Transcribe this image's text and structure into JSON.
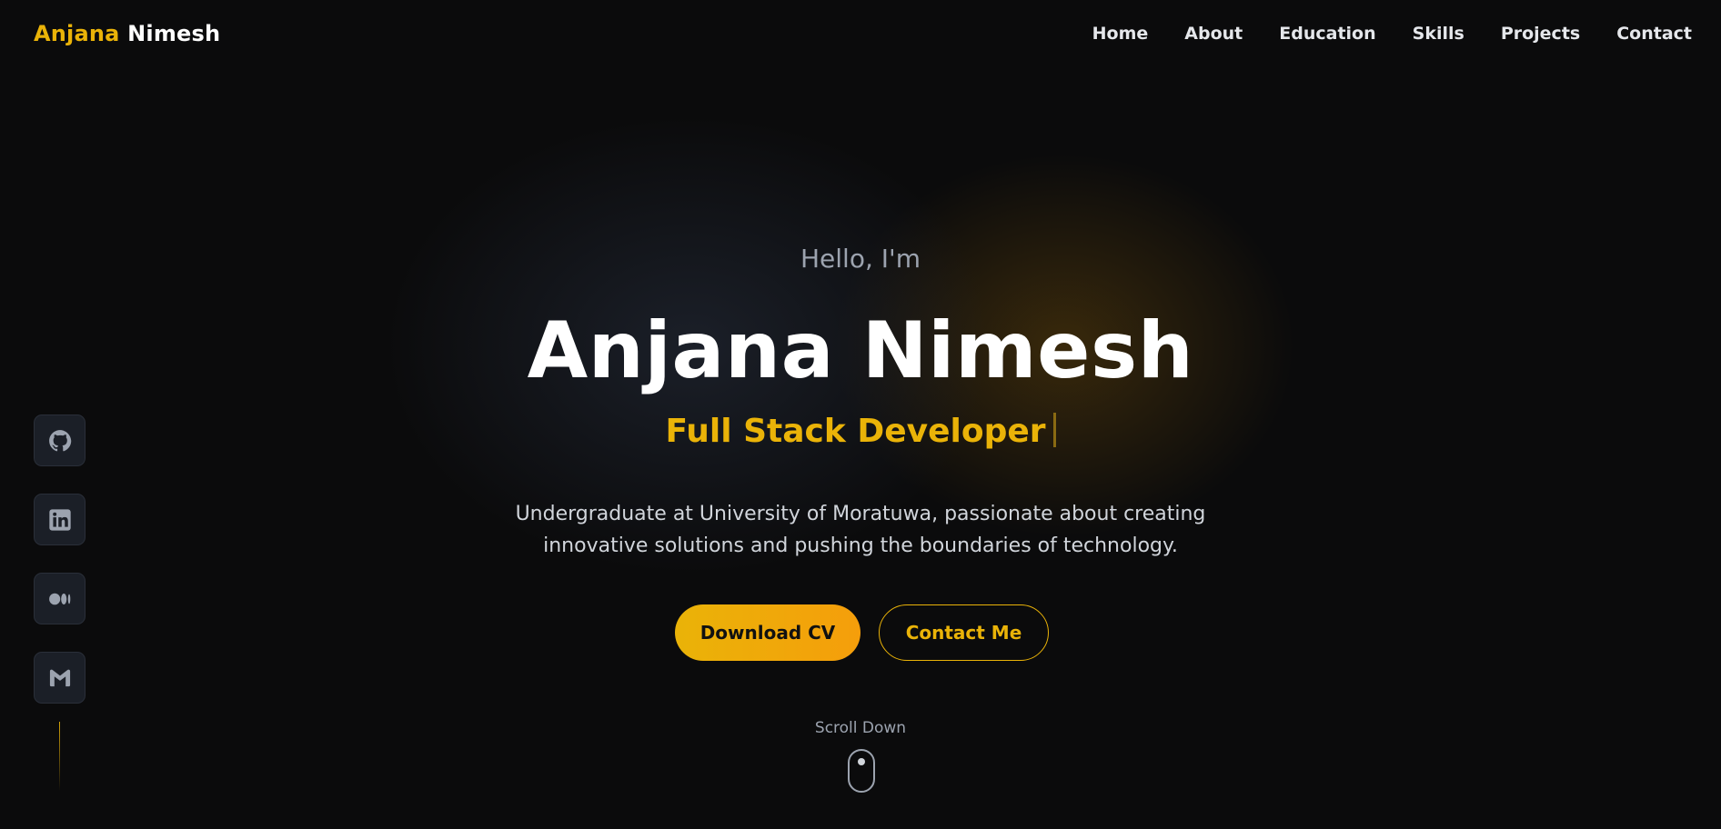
{
  "brand": {
    "first": "Anjana",
    "last": "Nimesh"
  },
  "nav": {
    "items": [
      {
        "label": "Home"
      },
      {
        "label": "About"
      },
      {
        "label": "Education"
      },
      {
        "label": "Skills"
      },
      {
        "label": "Projects"
      },
      {
        "label": "Contact"
      }
    ]
  },
  "social": {
    "items": [
      {
        "icon": "github-icon"
      },
      {
        "icon": "linkedin-icon"
      },
      {
        "icon": "medium-icon"
      },
      {
        "icon": "gmail-icon"
      }
    ]
  },
  "hero": {
    "greeting": "Hello, I'm",
    "name": "Anjana Nimesh",
    "role": "Full Stack Developer",
    "description": "Undergraduate at University of Moratuwa, passionate about creating innovative solutions and pushing the boundaries of technology.",
    "primary_button": "Download CV",
    "secondary_button": "Contact Me",
    "scroll_label": "Scroll Down"
  },
  "colors": {
    "accent": "#eab308",
    "accent_end": "#f59e0b",
    "background": "#0b0b0c",
    "text": "#ffffff",
    "muted": "#9ca3af"
  }
}
